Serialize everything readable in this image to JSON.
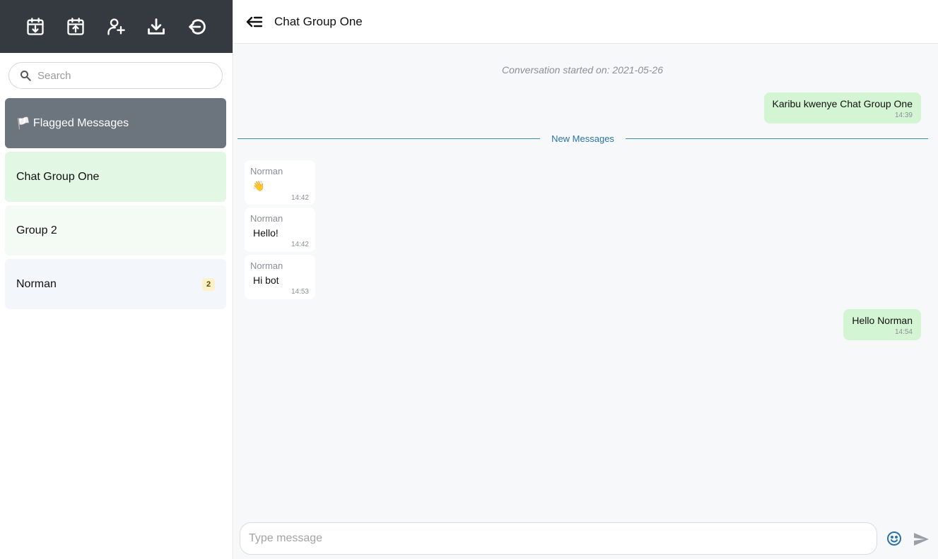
{
  "toolbar": {
    "icons": [
      "calendar-import-icon",
      "calendar-export-icon",
      "add-user-icon",
      "download-icon",
      "logout-icon"
    ]
  },
  "search": {
    "placeholder": "Search"
  },
  "rooms": [
    {
      "label": "Flagged Messages",
      "flag": "🏳️"
    },
    {
      "label": "Chat Group One"
    },
    {
      "label": "Group 2"
    },
    {
      "label": "Norman",
      "unread": "2"
    }
  ],
  "header": {
    "title": "Chat Group One"
  },
  "conversation": {
    "started": "Conversation started on: 2021-05-26",
    "divider_label": "New Messages",
    "messages": [
      {
        "direction": "out",
        "text": "Karibu kwenye Chat Group One",
        "time": "14:39"
      },
      {
        "direction": "in",
        "author": "Norman",
        "text": "👋",
        "time": "14:42"
      },
      {
        "direction": "in",
        "author": "Norman",
        "text": "Hello!",
        "time": "14:42"
      },
      {
        "direction": "in",
        "author": "Norman",
        "text": "Hi bot",
        "time": "14:53"
      },
      {
        "direction": "out",
        "text": "Hello Norman",
        "time": "14:54"
      }
    ]
  },
  "composer": {
    "placeholder": "Type message"
  },
  "colors": {
    "toolbar": "#343a40",
    "outgoing": "#d4f5d3",
    "divider": "#3c8ea6",
    "accent": "#2a73a8"
  }
}
